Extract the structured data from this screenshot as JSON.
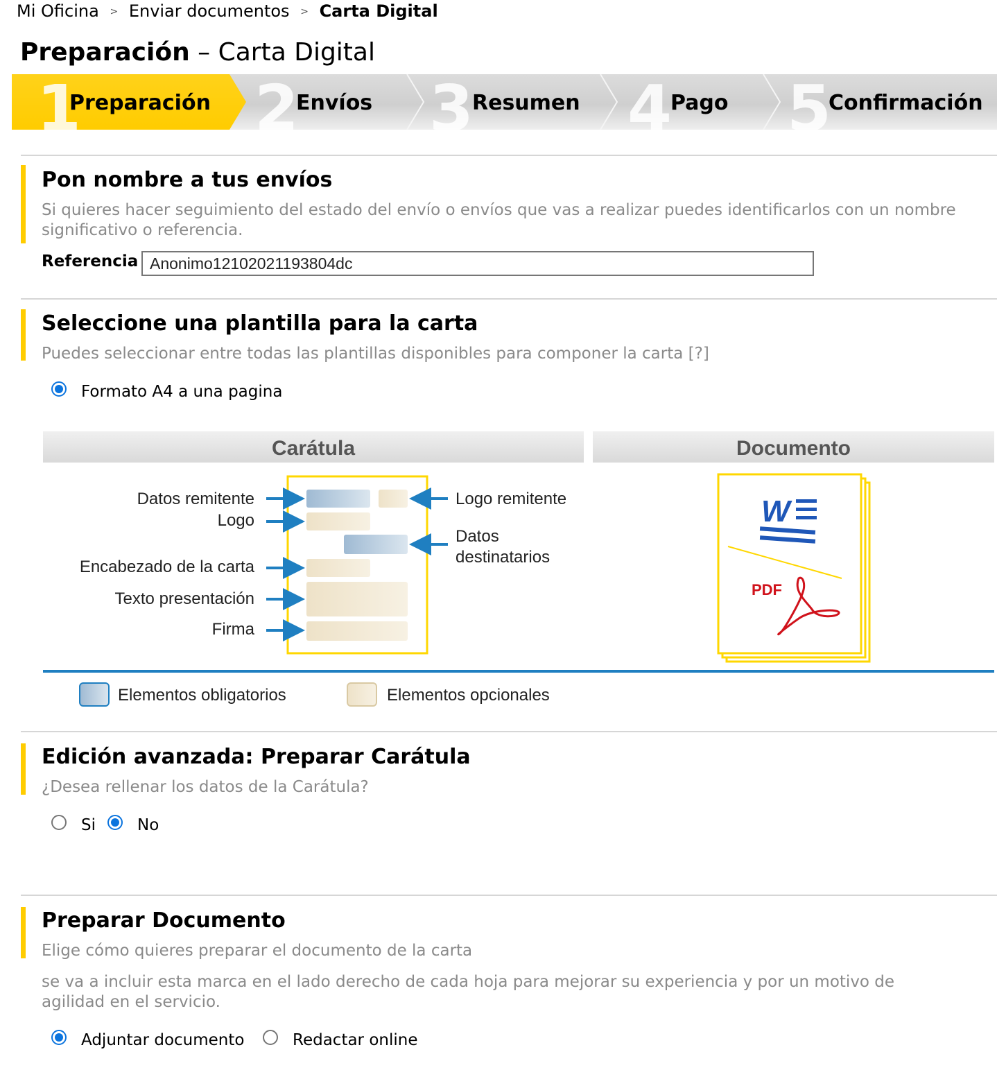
{
  "breadcrumb": {
    "items": [
      "Mi Oficina",
      "Enviar documentos"
    ],
    "separator": ">",
    "current": "Carta Digital"
  },
  "page_title": {
    "bold": "Preparación",
    "rest": " – Carta Digital"
  },
  "steps": [
    {
      "number": "1",
      "label": "Preparación"
    },
    {
      "number": "2",
      "label": "Envíos"
    },
    {
      "number": "3",
      "label": "Resumen"
    },
    {
      "number": "4",
      "label": "Pago"
    },
    {
      "number": "5",
      "label": "Confirmación"
    }
  ],
  "section_name": {
    "title": "Pon nombre a tus envíos",
    "description": "Si quieres hacer seguimiento del estado del envío o envíos que vas a realizar puedes identificarlos con un nombre significativo o referencia.",
    "field_label": "Referencia",
    "field_value": "Anonimo12102021193804dc"
  },
  "section_template": {
    "title": "Seleccione una plantilla para la carta",
    "description": "Puedes seleccionar entre todas las plantillas disponibles para componer la carta [?]",
    "option_label": "Formato A4 a una pagina",
    "diagram": {
      "caratula_header": "Carátula",
      "documento_header": "Documento",
      "labels": {
        "datos_remitente": "Datos remitente",
        "logo": "Logo",
        "encabezado": "Encabezado de la carta",
        "texto": "Texto presentación",
        "firma": "Firma",
        "logo_remitente": "Logo remitente",
        "datos_dest_1": "Datos",
        "datos_dest_2": "destinatarios",
        "pdf": "PDF"
      },
      "legend": {
        "mandatory": "Elementos obligatorios",
        "optional": "Elementos opcionales"
      }
    }
  },
  "section_advanced": {
    "title": "Edición avanzada: Preparar Carátula",
    "description": "¿Desea rellenar los datos de la Carátula?",
    "option_yes": "Si",
    "option_no": "No",
    "selected": "No"
  },
  "section_document": {
    "title": "Preparar Documento",
    "description": "Elige cómo quieres preparar el documento de la carta",
    "note": "se va a incluir esta marca en el lado derecho de cada hoja para mejorar su experiencia y por un motivo de agilidad en el servicio.",
    "option_attach": "Adjuntar documento",
    "option_online": "Redactar online",
    "selected": "Adjuntar documento"
  },
  "colors": {
    "accent_yellow": "#ffcc00",
    "radio_blue": "#0b74de",
    "diagram_blue": "#1f7fc1"
  }
}
